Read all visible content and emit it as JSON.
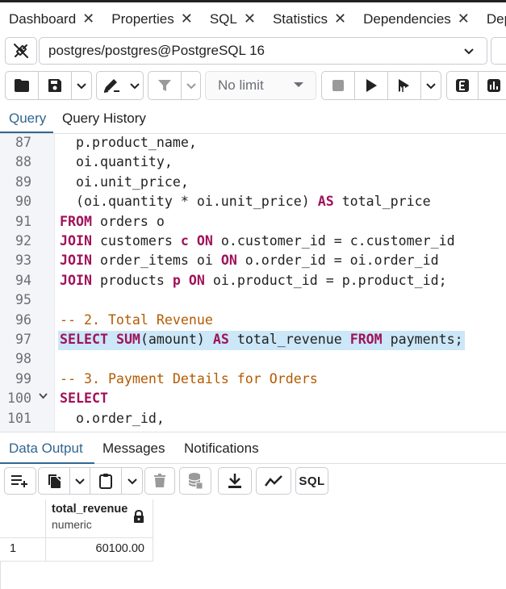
{
  "tabs": [
    {
      "label": "Dashboard"
    },
    {
      "label": "Properties"
    },
    {
      "label": "SQL"
    },
    {
      "label": "Statistics"
    },
    {
      "label": "Dependencies"
    },
    {
      "label": "Dep"
    }
  ],
  "close_glyph": "✕",
  "connection": {
    "label": "postgres/postgres@PostgreSQL 16"
  },
  "toolbar": {
    "limit_label": "No limit",
    "icons": [
      "folder-icon",
      "save-icon",
      "chevron-down-icon",
      "edit-pencil-icon",
      "chevron-down-icon",
      "filter-icon",
      "chevron-down-icon",
      "stop-icon",
      "execute-icon",
      "execute-script-icon",
      "chevron-down-icon",
      "explain-icon",
      "explain-analyze-icon"
    ]
  },
  "editor_tabs": [
    {
      "label": "Query"
    },
    {
      "label": "Query History"
    }
  ],
  "editor": {
    "lines": [
      {
        "num": "87",
        "text": "  p.product_name,"
      },
      {
        "num": "88",
        "text": "  oi.quantity,"
      },
      {
        "num": "89",
        "text": "  oi.unit_price,"
      },
      {
        "num": "90",
        "text": "  (oi.quantity * oi.unit_price) AS total_price"
      },
      {
        "num": "91",
        "text": "FROM orders o"
      },
      {
        "num": "92",
        "text": "JOIN customers c ON o.customer_id = c.customer_id"
      },
      {
        "num": "93",
        "text": "JOIN order_items oi ON o.order_id = oi.order_id"
      },
      {
        "num": "94",
        "text": "JOIN products p ON oi.product_id = p.product_id;"
      },
      {
        "num": "95",
        "text": ""
      },
      {
        "num": "96",
        "text": "-- 2. Total Revenue"
      },
      {
        "num": "97",
        "text": "SELECT SUM(amount) AS total_revenue FROM payments;"
      },
      {
        "num": "98",
        "text": ""
      },
      {
        "num": "99",
        "text": "-- 3. Payment Details for Orders"
      },
      {
        "num": "100",
        "text": "SELECT"
      },
      {
        "num": "101",
        "text": "  o.order_id,"
      }
    ],
    "highlighted_line": "97",
    "folded_line": "100",
    "colors": {
      "keyword": "#a0125a",
      "comment": "#b35a00",
      "selection": "#cce7f7"
    }
  },
  "results_tabs": [
    {
      "label": "Data Output"
    },
    {
      "label": "Messages"
    },
    {
      "label": "Notifications"
    }
  ],
  "results_toolbar": {
    "sql_label": "SQL",
    "icons": [
      "add-row-icon",
      "copy-icon",
      "chevron-down-icon",
      "paste-icon",
      "chevron-down-icon",
      "delete-icon",
      "save-data-icon",
      "download-icon",
      "graph-icon"
    ]
  },
  "grid": {
    "columns": [
      {
        "name": "total_revenue",
        "type": "numeric"
      }
    ],
    "rows": [
      {
        "num": "1",
        "values": [
          "60100.00"
        ]
      }
    ]
  },
  "accent_color": "#326690"
}
